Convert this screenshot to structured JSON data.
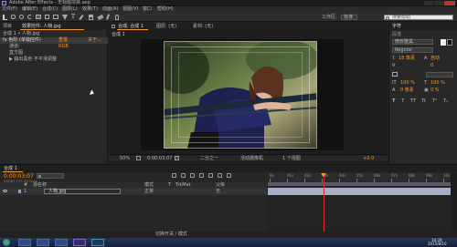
{
  "title_bar": {
    "title": "Adobe After Effects - 无标题项目.aep"
  },
  "menu": {
    "items": [
      "文件(F)",
      "编辑(E)",
      "合成(C)",
      "图层(L)",
      "效果(T)",
      "动画(A)",
      "视图(V)",
      "窗口",
      "帮助(H)"
    ]
  },
  "toolbar": {
    "workspace_label": "工作区:",
    "workspace_value": "标准",
    "search_placeholder": "搜索帮助"
  },
  "left_panel": {
    "tabs": [
      "项目",
      "效果控件: 人物.jpg"
    ],
    "header": "合成 1 • 人物.jpg",
    "rows": [
      {
        "name": "fx 色阶 (单独控件)",
        "value": "重置",
        "extra": "关于..."
      },
      {
        "name": "通道:",
        "value": "RGB"
      },
      {
        "name": "直方图",
        "value": ""
      }
    ],
    "row_more": "▶ 输出黑色  不平滑调整"
  },
  "viewer": {
    "tabs": [
      "合成: 合成 1",
      "图层: (无)",
      "素材: (无)"
    ],
    "subtab": "合成 1",
    "status": {
      "zoom": "50%",
      "timecode": "0:00:03:07",
      "quality": "二分之一",
      "camera": "活动摄像机",
      "views": "1 个视图",
      "offset": "+0.0"
    }
  },
  "right_panel": {
    "tab": "字符",
    "tab2": "段落",
    "font": "微软雅黑",
    "style": "Regular",
    "size": "18 像素",
    "leading": "自动",
    "tracking": "0",
    "scale_v": "100 %",
    "scale_h": "100 %",
    "baseline": "0 像素",
    "tsume": "0 %",
    "styles": [
      "T",
      "T",
      "TT",
      "Tt",
      "T¹",
      "T₁"
    ]
  },
  "timeline": {
    "tab": "合成 1",
    "timecode": "0:00:03:07",
    "fps": "00082 (25.00 fps)",
    "search_placeholder": "",
    "headers": [
      "#",
      "源名称",
      "模式",
      "T",
      "TrkMat",
      "父级"
    ],
    "layer": {
      "num": "1",
      "name": "人物.jpg",
      "mode": "正常",
      "parent": "无"
    },
    "ruler": [
      "0s",
      "01s",
      "02s",
      "03s",
      "04s",
      "05s",
      "06s",
      "07s",
      "08s",
      "09s",
      "10s"
    ],
    "footer": "切换开关 / 模式"
  },
  "taskbar": {
    "items": [
      "start",
      "ie",
      "folder",
      "media",
      "ae",
      "ps"
    ],
    "time": "16:28",
    "date": "2015/8/10"
  },
  "colors": {
    "accent": "#f29a2a",
    "playhead": "#d9342b",
    "taskbar": "#1a2a44"
  },
  "playback": {
    "current_time_fraction": 0.305
  }
}
